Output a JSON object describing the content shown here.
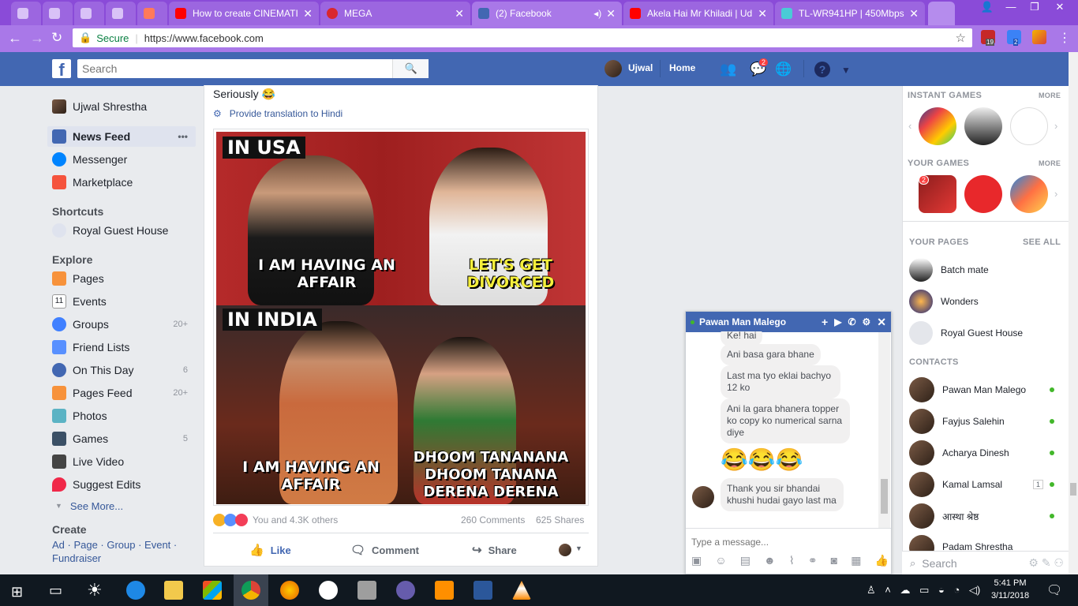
{
  "browser": {
    "tabs": [
      {
        "label": "",
        "icon": "pinned-tab-icon",
        "color": "#d9c2f7"
      },
      {
        "label": "",
        "icon": "pinned-tab-icon",
        "color": "#d9c2f7"
      },
      {
        "label": "",
        "icon": "pinned-tab-icon",
        "color": "#d9c2f7"
      },
      {
        "label": "",
        "icon": "pinned-tab-icon",
        "color": "#d9c2f7"
      },
      {
        "label": "",
        "icon": "hubspot-icon",
        "color": "#ff7a59"
      },
      {
        "label": "How to create CINEMATI",
        "icon": "youtube-icon",
        "color": "#ff0000"
      },
      {
        "label": "MEGA",
        "icon": "mega-icon",
        "color": "#d9272e"
      },
      {
        "label": "(2) Facebook",
        "icon": "facebook-icon",
        "color": "#4267b2"
      },
      {
        "label": "Akela Hai Mr Khiladi | Ud",
        "icon": "youtube-icon",
        "color": "#ff0000"
      },
      {
        "label": "TL-WR941HP | 450Mbps",
        "icon": "tplink-icon",
        "color": "#4acbd6"
      }
    ],
    "secure_label": "Secure",
    "url": "https://www.facebook.com",
    "ext_badges": [
      "19",
      "2"
    ]
  },
  "fb": {
    "search_placeholder": "Search",
    "user_short": "Ujwal",
    "home": "Home",
    "msg_badge": "2"
  },
  "left_nav": {
    "user": "Ujwal Shrestha",
    "items": [
      {
        "label": "News Feed",
        "icon": "news-feed-icon",
        "color": "#4267b2"
      },
      {
        "label": "Messenger",
        "icon": "messenger-icon",
        "color": "#0084ff"
      },
      {
        "label": "Marketplace",
        "icon": "marketplace-icon",
        "color": "#f5533d"
      }
    ],
    "more_dots": "•••",
    "shortcuts_title": "Shortcuts",
    "shortcut": "Royal Guest House",
    "explore_title": "Explore",
    "explore": [
      {
        "label": "Pages",
        "count": "",
        "icon": "pages-icon",
        "color": "#f7923b"
      },
      {
        "label": "Events",
        "count": "",
        "icon": "events-icon",
        "color": "#e4e6eb"
      },
      {
        "label": "Groups",
        "count": "20+",
        "icon": "groups-icon",
        "color": "#4080ff"
      },
      {
        "label": "Friend Lists",
        "count": "",
        "icon": "friend-lists-icon",
        "color": "#5890ff"
      },
      {
        "label": "On This Day",
        "count": "6",
        "icon": "on-this-day-icon",
        "color": "#4267b2"
      },
      {
        "label": "Pages Feed",
        "count": "20+",
        "icon": "pages-feed-icon",
        "color": "#f7923b"
      },
      {
        "label": "Photos",
        "count": "",
        "icon": "photos-icon",
        "color": "#5bb3c4"
      },
      {
        "label": "Games",
        "count": "5",
        "icon": "games-icon",
        "color": "#3b5066"
      },
      {
        "label": "Live Video",
        "count": "",
        "icon": "live-video-icon",
        "color": "#444"
      },
      {
        "label": "Suggest Edits",
        "count": "",
        "icon": "suggest-edits-icon",
        "color": "#f02849"
      }
    ],
    "see_more": "See More...",
    "create_title": "Create",
    "create_links": "Ad · Page · Group · Event ·",
    "create_links2": "Fundraiser"
  },
  "post": {
    "text": "Seriously 😂",
    "translate": "Provide translation to Hindi",
    "meme": {
      "tag1": "IN USA",
      "cap1a": "I AM HAVING AN AFFAIR",
      "cap1b": "LET'S GET DIVORCED",
      "tag2": "IN INDIA",
      "cap2a": "I AM HAVING AN AFFAIR",
      "cap2b": "DHOOM TANANANA DHOOM TANANA DERENA DERENA"
    },
    "reactions": "You and 4.3K others",
    "comments": "260 Comments",
    "shares": "625 Shares",
    "like": "Like",
    "comment": "Comment",
    "share": "Share"
  },
  "right": {
    "instant_games": "INSTANT GAMES",
    "more": "MORE",
    "your_games": "YOUR GAMES",
    "games_badge": "2",
    "your_pages": "YOUR PAGES",
    "see_all": "SEE ALL",
    "pages": [
      "Batch mate",
      "Wonders",
      "Royal Guest House"
    ],
    "contacts_title": "CONTACTS",
    "contacts": [
      {
        "name": "Pawan Man Malego",
        "badge": ""
      },
      {
        "name": "Fayjus Salehin",
        "badge": ""
      },
      {
        "name": "Acharya Dinesh",
        "badge": ""
      },
      {
        "name": "Kamal Lamsal",
        "badge": "1"
      },
      {
        "name": "आस्था श्रेष्ठ",
        "badge": ""
      },
      {
        "name": "Padam Shrestha",
        "badge": ""
      }
    ],
    "search_placeholder": "Search"
  },
  "chat": {
    "name": "Pawan Man Malego",
    "messages": [
      "Ke! hai",
      "Ani basa gara bhane",
      "Last ma tyo eklai bachyo 12 ko",
      "Ani la gara bhanera topper ko copy ko numerical sarna diye",
      "😂😂😂",
      "Thank you sir bhandai khushi hudai gayo last ma"
    ],
    "input_placeholder": "Type a message..."
  },
  "taskbar": {
    "time": "5:41 PM",
    "date": "3/11/2018"
  }
}
